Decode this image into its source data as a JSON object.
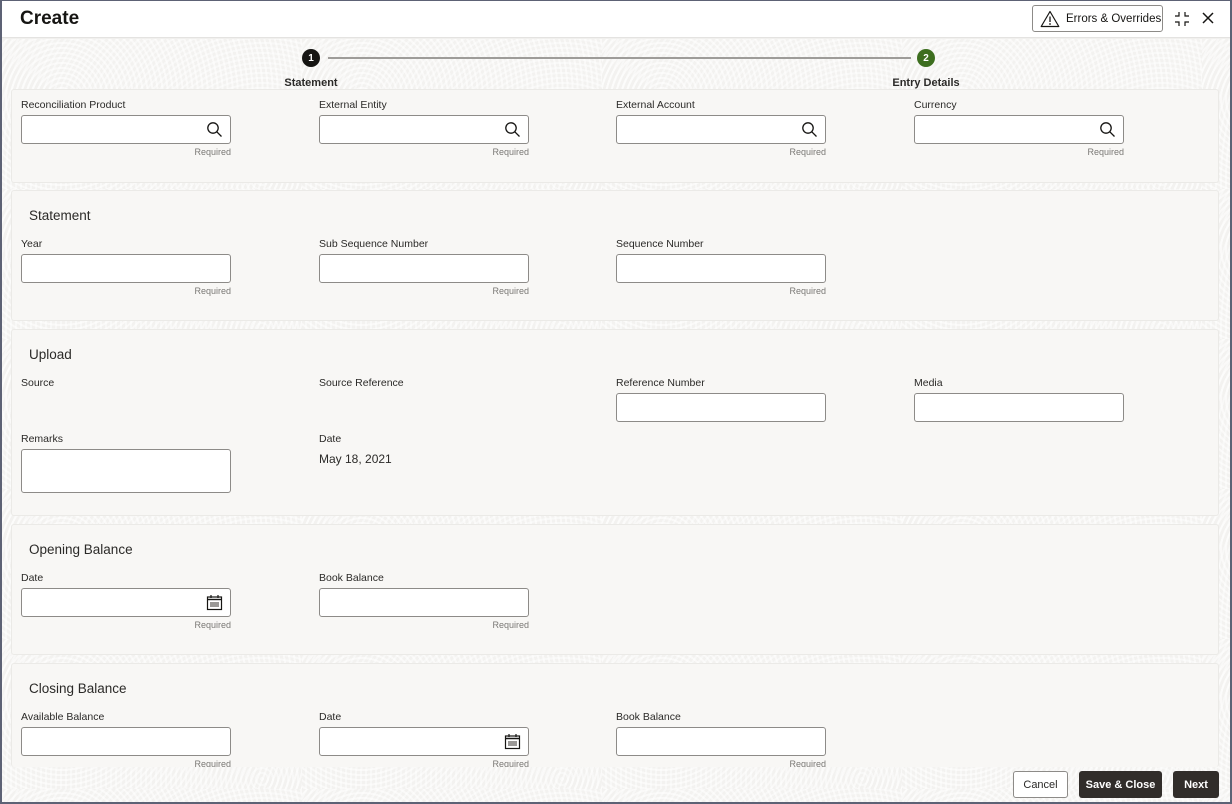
{
  "window": {
    "title": "Create",
    "errors_button": "Errors & Overrides"
  },
  "train": {
    "steps": [
      {
        "number": "1",
        "label": "Statement",
        "state": "current"
      },
      {
        "number": "2",
        "label": "Entry Details",
        "state": "next"
      }
    ]
  },
  "required_text": "Required",
  "product_section": {
    "fields": [
      {
        "label": "Reconciliation Product",
        "value": "",
        "icon": "search-icon",
        "required": true
      },
      {
        "label": "External Entity",
        "value": "",
        "icon": "search-icon",
        "required": true
      },
      {
        "label": "External Account",
        "value": "",
        "icon": "search-icon",
        "required": true
      },
      {
        "label": "Currency",
        "value": "",
        "icon": "search-icon",
        "required": true
      }
    ]
  },
  "statement_section": {
    "title": "Statement",
    "fields": [
      {
        "label": "Year",
        "value": "",
        "required": true
      },
      {
        "label": "Sub Sequence Number",
        "value": "",
        "required": true
      },
      {
        "label": "Sequence Number",
        "value": "",
        "required": true
      }
    ]
  },
  "upload_section": {
    "title": "Upload",
    "fields": [
      {
        "label": "Source",
        "value": ""
      },
      {
        "label": "Source Reference",
        "value": ""
      },
      {
        "label": "Reference Number",
        "value": ""
      },
      {
        "label": "Media",
        "value": ""
      },
      {
        "label": "Remarks",
        "value": ""
      },
      {
        "label": "Date",
        "value": "May 18, 2021"
      }
    ]
  },
  "opening_balance_section": {
    "title": "Opening Balance",
    "fields": [
      {
        "label": "Date",
        "value": "",
        "icon": "calendar-icon",
        "required": true
      },
      {
        "label": "Book Balance",
        "value": "",
        "required": true
      }
    ]
  },
  "closing_balance_section": {
    "title": "Closing Balance",
    "fields": [
      {
        "label": "Available Balance",
        "value": "",
        "required": true
      },
      {
        "label": "Date",
        "value": "",
        "icon": "calendar-icon",
        "required": true
      },
      {
        "label": "Book Balance",
        "value": "",
        "required": true
      }
    ]
  },
  "footer": {
    "cancel": "Cancel",
    "save_close": "Save & Close",
    "next": "Next"
  },
  "colors": {
    "primary_button": "#312d2a",
    "step_current": "#161513",
    "step_next": "#3d6e1f"
  }
}
